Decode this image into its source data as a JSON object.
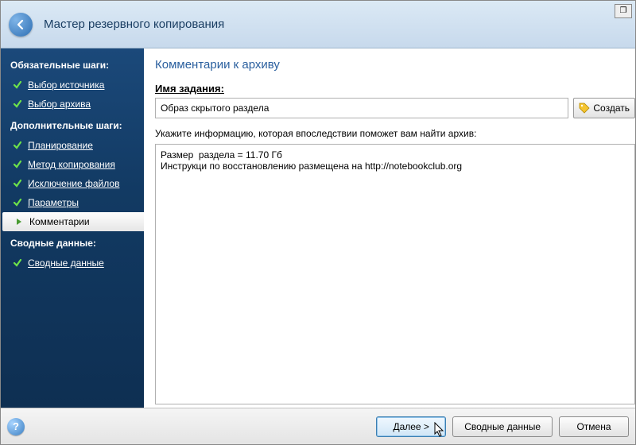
{
  "header": {
    "title": "Мастер резервного копирования"
  },
  "sidebar": {
    "section1": "Обязательные шаги:",
    "section2": "Дополнительные шаги:",
    "section3": "Сводные данные:",
    "steps1": [
      {
        "label": "Выбор источника"
      },
      {
        "label": "Выбор архива"
      }
    ],
    "steps2": [
      {
        "label": "Планирование"
      },
      {
        "label": "Метод копирования"
      },
      {
        "label": "Исключение файлов"
      },
      {
        "label": "Параметры"
      },
      {
        "label": "Комментарии"
      }
    ],
    "steps3": [
      {
        "label": "Сводные данные"
      }
    ]
  },
  "main": {
    "title": "Комментарии к архиву",
    "task_label": "Имя задания:",
    "task_value": "Образ скрытого раздела",
    "create_label": "Создать",
    "hint": "Укажите информацию, которая впоследствии поможет вам найти архив:",
    "comment_text": "Размер  раздела = 11.70 Гб\nИнструкци по восстановлению размещена на http://notebookclub.org"
  },
  "footer": {
    "next": "Далее >",
    "summary": "Сводные данные",
    "cancel": "Отмена"
  }
}
